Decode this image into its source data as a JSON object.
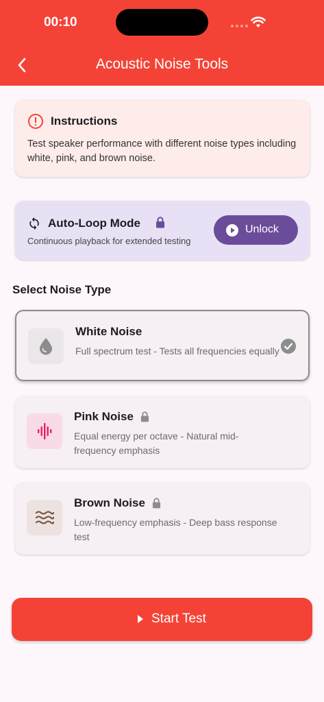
{
  "status_bar": {
    "time": "00:10"
  },
  "header": {
    "title": "Acoustic Noise Tools"
  },
  "instructions": {
    "title": "Instructions",
    "text": "Test speaker performance with different noise types including white, pink, and brown noise."
  },
  "auto_loop": {
    "title": "Auto-Loop Mode",
    "subtitle": "Continuous playback for extended testing",
    "button_label": "Unlock"
  },
  "section": {
    "label": "Select Noise Type"
  },
  "noise_types": [
    {
      "title": "White Noise",
      "description": "Full spectrum test - Tests all frequencies equally",
      "icon": "water-drop-icon",
      "locked": false,
      "selected": true
    },
    {
      "title": "Pink Noise",
      "description": "Equal energy per octave - Natural mid-frequency emphasis",
      "icon": "graphic-eq-icon",
      "locked": true,
      "selected": false
    },
    {
      "title": "Brown Noise",
      "description": "Low-frequency emphasis - Deep bass response test",
      "icon": "waves-icon",
      "locked": true,
      "selected": false
    }
  ],
  "start_button": {
    "label": "Start Test"
  },
  "colors": {
    "primary": "#f44336",
    "purple": "#6b4c9a",
    "pink_icon": "#e91e63",
    "brown_icon": "#795548",
    "instructions_bg": "#feecea",
    "autoloop_bg": "#e8e0f5"
  }
}
